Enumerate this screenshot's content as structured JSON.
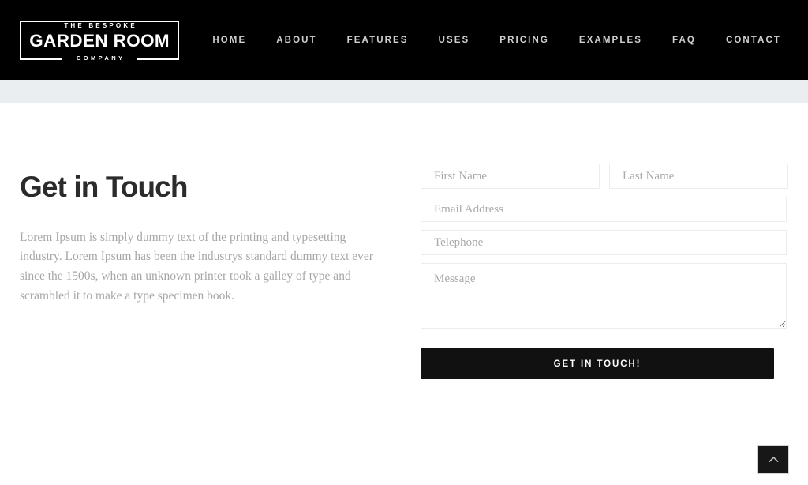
{
  "header": {
    "logo": {
      "top_line": "THE BESPOKE",
      "main_line": "GARDEN ROOM",
      "bottom_line": "COMPANY",
      "name": "The Bespoke Garden Room Company"
    },
    "nav_items": [
      {
        "label": "HOME"
      },
      {
        "label": "ABOUT"
      },
      {
        "label": "FEATURES"
      },
      {
        "label": "USES"
      },
      {
        "label": "PRICING"
      },
      {
        "label": "EXAMPLES"
      },
      {
        "label": "FAQ"
      },
      {
        "label": "CONTACT"
      }
    ],
    "background_color": "#000000",
    "nav_text_color": "#cfcfcf"
  },
  "band": {
    "background_color": "#eaeef0"
  },
  "main": {
    "title": "Get in Touch",
    "intro_paragraph": "Lorem Ipsum is simply dummy text of the printing and typesetting industry. Lorem Ipsum has been the industrys standard dummy text ever since the 1500s, when an unknown printer took a galley of type and scrambled it to make a type specimen book.",
    "title_color": "#2b2b2b",
    "body_text_color": "#a6a6a6"
  },
  "form": {
    "fields": {
      "first_name": {
        "placeholder": "First Name",
        "value": ""
      },
      "last_name": {
        "placeholder": "Last Name",
        "value": ""
      },
      "email": {
        "placeholder": "Email Address",
        "value": ""
      },
      "telephone": {
        "placeholder": "Telephone",
        "value": ""
      },
      "message": {
        "placeholder": "Message",
        "value": ""
      }
    },
    "submit_label": "GET IN TOUCH!",
    "submit_background": "#111111",
    "submit_text_color": "#ffffff",
    "field_border_color": "#ececec",
    "placeholder_color": "#a9a9a9"
  },
  "scroll_top": {
    "icon": "chevron-up-icon",
    "background_color": "#171717"
  }
}
